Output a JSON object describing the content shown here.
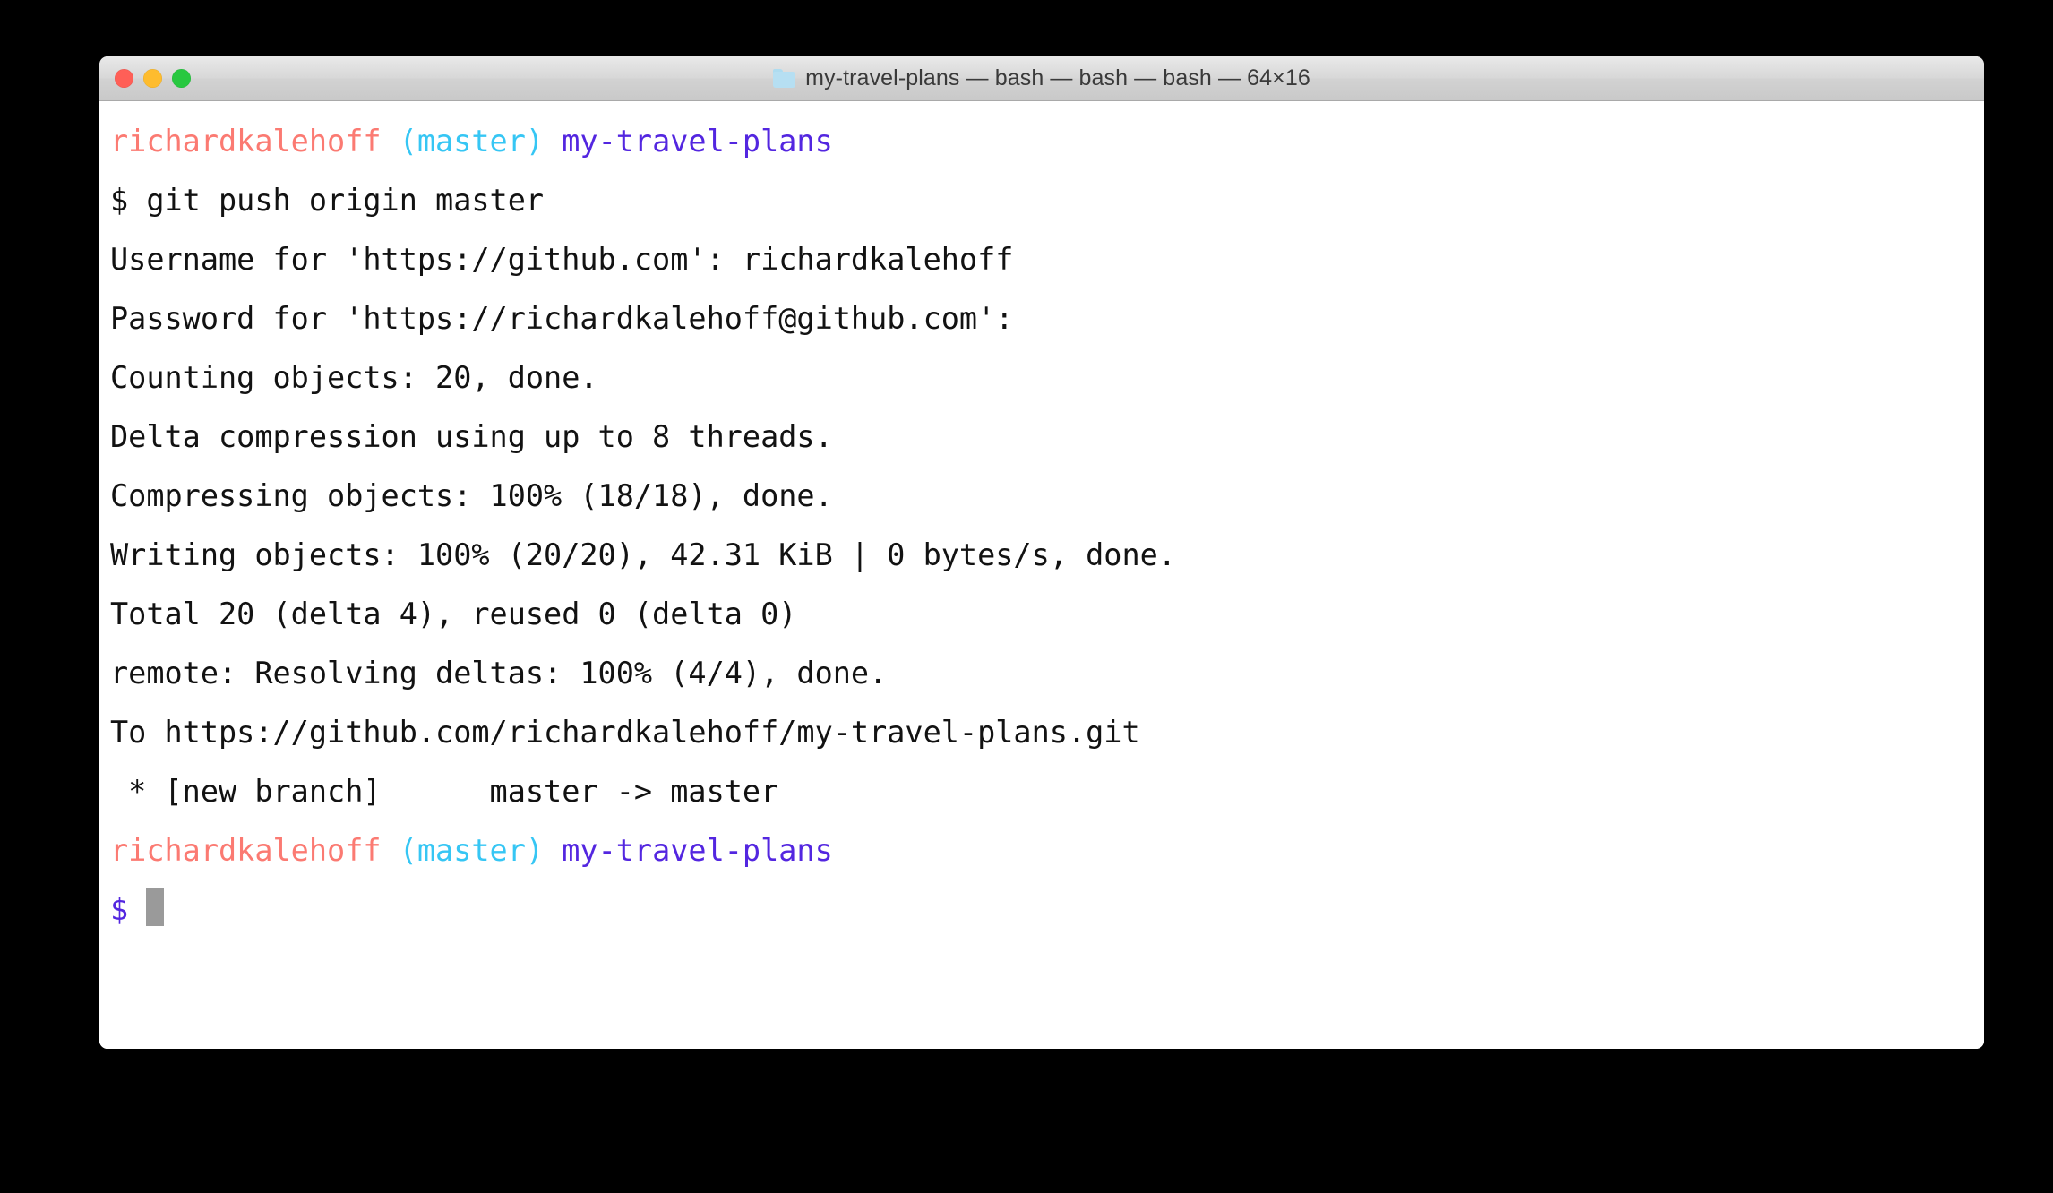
{
  "window": {
    "title": "my-travel-plans — bash — bash — bash — 64×16",
    "folder_name": "my-travel-plans",
    "shell": "bash",
    "dimensions": "64×16",
    "controls": [
      "close",
      "minimize",
      "zoom"
    ]
  },
  "theme": {
    "background": "#000000",
    "terminal_background": "#ffffff",
    "text": "#121212",
    "user_color": "#fb7a72",
    "branch_color": "#36c6f4",
    "path_color": "#5326e0",
    "cursor_color": "#9a9a9a",
    "titlebar_start": "#e9e9e9",
    "titlebar_end": "#c9c9c9",
    "close_button": "#ff5f57",
    "minimize_button": "#febc2e",
    "zoom_button": "#28c840"
  },
  "terminal": {
    "user": "richardkalehoff",
    "branch": "(master)",
    "directory": "my-travel-plans",
    "command": "$ git push origin master",
    "lines": [
      {
        "type": "prompt",
        "segments": [
          {
            "text": "richardkalehoff",
            "color": "user"
          },
          {
            "text": " ",
            "color": "default"
          },
          {
            "text": "(master)",
            "color": "branch"
          },
          {
            "text": " ",
            "color": "default"
          },
          {
            "text": "my-travel-plans",
            "color": "path"
          }
        ]
      },
      {
        "type": "command",
        "segments": [
          {
            "text": "$ git push origin master",
            "color": "default"
          }
        ]
      },
      {
        "type": "output",
        "segments": [
          {
            "text": "Username for 'https://github.com': richardkalehoff",
            "color": "default"
          }
        ]
      },
      {
        "type": "output",
        "segments": [
          {
            "text": "Password for 'https://richardkalehoff@github.com':",
            "color": "default"
          }
        ]
      },
      {
        "type": "output",
        "segments": [
          {
            "text": "Counting objects: 20, done.",
            "color": "default"
          }
        ]
      },
      {
        "type": "output",
        "segments": [
          {
            "text": "Delta compression using up to 8 threads.",
            "color": "default"
          }
        ]
      },
      {
        "type": "output",
        "segments": [
          {
            "text": "Compressing objects: 100% (18/18), done.",
            "color": "default"
          }
        ]
      },
      {
        "type": "output",
        "segments": [
          {
            "text": "Writing objects: 100% (20/20), 42.31 KiB | 0 bytes/s, done.",
            "color": "default"
          }
        ]
      },
      {
        "type": "output",
        "segments": [
          {
            "text": "Total 20 (delta 4), reused 0 (delta 0)",
            "color": "default"
          }
        ]
      },
      {
        "type": "output",
        "segments": [
          {
            "text": "remote: Resolving deltas: 100% (4/4), done.",
            "color": "default"
          }
        ]
      },
      {
        "type": "output",
        "segments": [
          {
            "text": "To https://github.com/richardkalehoff/my-travel-plans.git",
            "color": "default"
          }
        ]
      },
      {
        "type": "output",
        "segments": [
          {
            "text": " * [new branch]      master -> master",
            "color": "default"
          }
        ]
      },
      {
        "type": "prompt",
        "segments": [
          {
            "text": "richardkalehoff",
            "color": "user"
          },
          {
            "text": " ",
            "color": "default"
          },
          {
            "text": "(master)",
            "color": "branch"
          },
          {
            "text": " ",
            "color": "default"
          },
          {
            "text": "my-travel-plans",
            "color": "path"
          }
        ]
      },
      {
        "type": "input",
        "cursor": true,
        "segments": [
          {
            "text": "$ ",
            "color": "dollar"
          }
        ]
      }
    ]
  }
}
